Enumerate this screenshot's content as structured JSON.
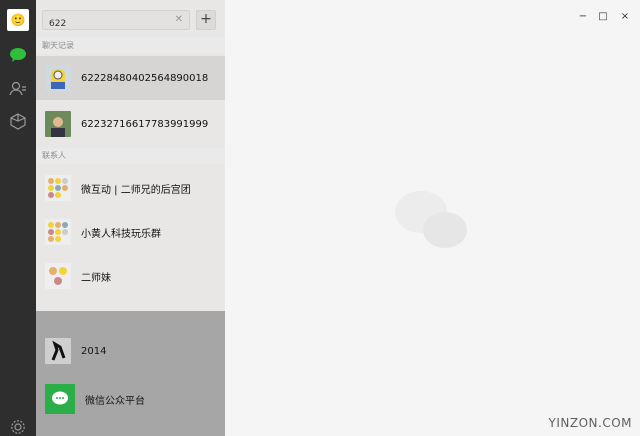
{
  "search": {
    "value": "622",
    "clear_icon": "clear-icon"
  },
  "add_button": {
    "label": "+"
  },
  "sections": {
    "chat_history": "聊天记录",
    "contacts": "联系人"
  },
  "chat_results": [
    {
      "name": "6222848040256489​0018"
    },
    {
      "name": "6223271661778399​1999"
    }
  ],
  "contact_results": [
    {
      "name": "微互动 | 二师兄的后宫团"
    },
    {
      "name": "小黄人科技玩乐群"
    },
    {
      "name": "二师妹"
    }
  ],
  "background_chats": [
    {
      "name": "2014"
    },
    {
      "name": "微信公众平台"
    }
  ],
  "window": {
    "minimize": "−",
    "maximize": "□",
    "close": "×"
  },
  "watermark": "YINZON.COM"
}
